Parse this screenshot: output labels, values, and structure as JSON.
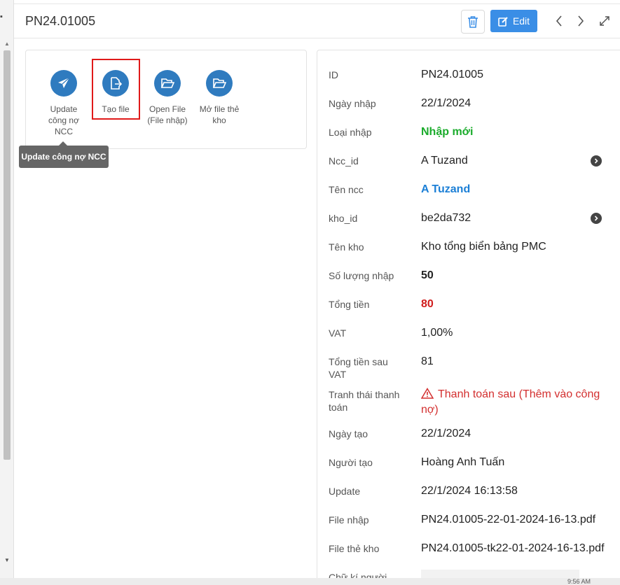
{
  "header": {
    "title": "PN24.01005",
    "edit_label": "Edit"
  },
  "actions": [
    {
      "label": "Update công nợ NCC",
      "icon": "paper-plane-icon"
    },
    {
      "label": "Tạo file",
      "icon": "file-export-icon"
    },
    {
      "label": "Open File (File nhập)",
      "icon": "folder-open-icon"
    },
    {
      "label": "Mở file thẻ kho",
      "icon": "folder-open-icon"
    }
  ],
  "tooltip": "Update công nợ NCC",
  "details": [
    {
      "key": "ID",
      "value": "PN24.01005"
    },
    {
      "key": "Ngày nhập",
      "value": "22/1/2024"
    },
    {
      "key": "Loại nhập",
      "value": "Nhập mới"
    },
    {
      "key": "Ncc_id",
      "value": "A Tuzand"
    },
    {
      "key": "Tên ncc",
      "value": "A Tuzand"
    },
    {
      "key": "kho_id",
      "value": "be2da732"
    },
    {
      "key": "Tên kho",
      "value": "Kho tổng biển bảng PMC"
    },
    {
      "key": "Số lượng nhập",
      "value": "50"
    },
    {
      "key": "Tổng tiền",
      "value": "80"
    },
    {
      "key": "VAT",
      "value": "1,00%"
    },
    {
      "key": "Tổng tiền sau VAT",
      "value": "81"
    },
    {
      "key": "Tranh thái thanh toán",
      "value": "Thanh toán sau (Thêm vào công nợ)"
    },
    {
      "key": "Ngày tạo",
      "value": "22/1/2024"
    },
    {
      "key": "Người tạo",
      "value": "Hoàng Anh Tuấn"
    },
    {
      "key": "Update",
      "value": "22/1/2024 16:13:58"
    },
    {
      "key": "File nhập",
      "value": "PN24.01005-22-01-2024-16-13.pdf"
    },
    {
      "key": "File thẻ kho",
      "value": "PN24.01005-tk22-01-2024-16-13.pdf"
    },
    {
      "key": "Chữ kí người",
      "value": ""
    }
  ],
  "colors": {
    "primary": "#3a8ee6",
    "action_circle": "#2f7bbf",
    "success": "#1aab2b",
    "link": "#1b7fd6",
    "danger": "#d01c1c",
    "highlight": "#e01a1a"
  },
  "bottom": {
    "clock_fragment": "9:56 AM"
  }
}
